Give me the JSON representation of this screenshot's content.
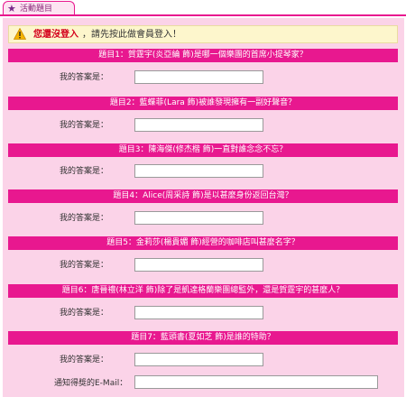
{
  "tab": {
    "label": "活動題目"
  },
  "notice": {
    "highlight": "您還沒登入",
    "message": "，請先按此做會員登入！"
  },
  "questions": [
    {
      "title": "題目1：賀霆宇(炎亞綸 飾)是哪一個樂團的首席小提琴家？"
    },
    {
      "title": "題目2：藍蝶菲(Lara 飾)被誰發現擁有一副好聲音？"
    },
    {
      "title": "題目3：陳海傑(修杰楷 飾)一直對誰念念不忘？"
    },
    {
      "title": "題目4：Alice(周采詩 飾)是以甚麼身份返回台灣？"
    },
    {
      "title": "題目5：金莉莎(楊貴媚 飾)經營的咖啡店叫甚麼名字？"
    },
    {
      "title": "題目6：唐晉禮(林立洋 飾)除了是凱達格蘭樂團總監外，還是賀霆宇的甚麼人？"
    },
    {
      "title": "題目7：藍頭書(夏如芝 飾)是誰的特助？"
    }
  ],
  "answer_label": "我的答案是：",
  "email_label": "通知得獎的E-Mail：",
  "colors": {
    "accent": "#e8188f",
    "panel": "#fbd3e8",
    "notice_bg": "#fdf6cc",
    "notice_text": "#d4001c"
  }
}
